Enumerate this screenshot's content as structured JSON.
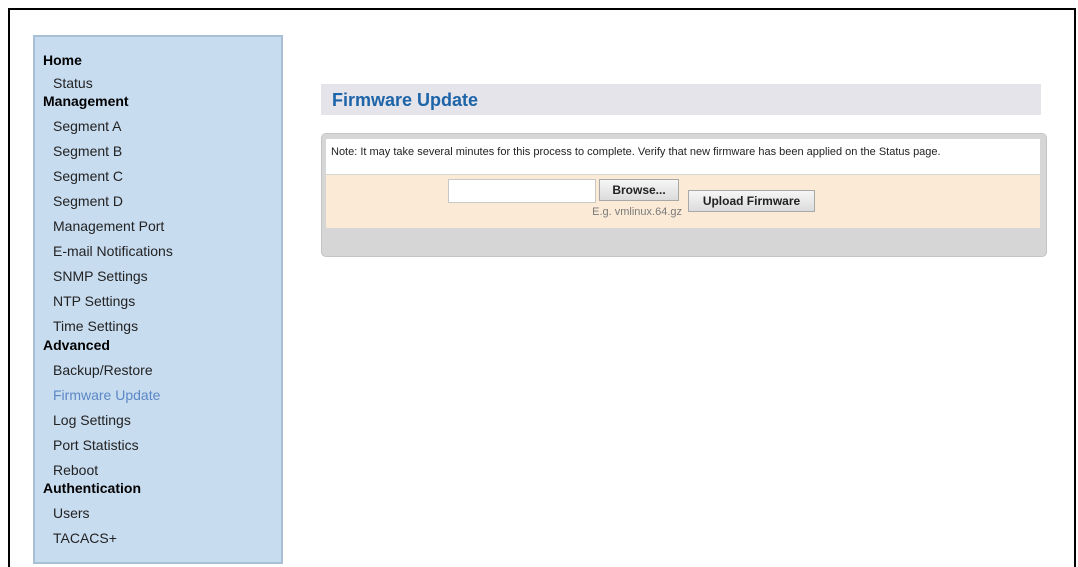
{
  "sidebar": {
    "home": "Home",
    "status": "Status",
    "management": "Management",
    "segment_a": "Segment A",
    "segment_b": "Segment B",
    "segment_c": "Segment C",
    "segment_d": "Segment D",
    "management_port": "Management Port",
    "email_notifications": "E-mail Notifications",
    "snmp_settings": "SNMP Settings",
    "ntp_settings": "NTP Settings",
    "time_settings": "Time Settings",
    "advanced": "Advanced",
    "backup_restore": "Backup/Restore",
    "firmware_update": "Firmware Update",
    "log_settings": "Log Settings",
    "port_statistics": "Port Statistics",
    "reboot": "Reboot",
    "authentication": "Authentication",
    "users": "Users",
    "tacacs": "TACACS+"
  },
  "main": {
    "title": "Firmware Update",
    "note": "Note: It may take several minutes for this process to complete. Verify that new firmware has been applied on the Status page.",
    "file_value": "",
    "browse_label": "Browse...",
    "example_hint": "E.g. vmlinux.64.gz",
    "upload_label": "Upload Firmware"
  },
  "colors": {
    "sidebar_bg": "#c8dcf0",
    "active_nav": "#5b87c5",
    "title_text": "#1d64a8",
    "form_row_bg": "#fbebd6",
    "panel_bg": "#d6d6d6"
  }
}
